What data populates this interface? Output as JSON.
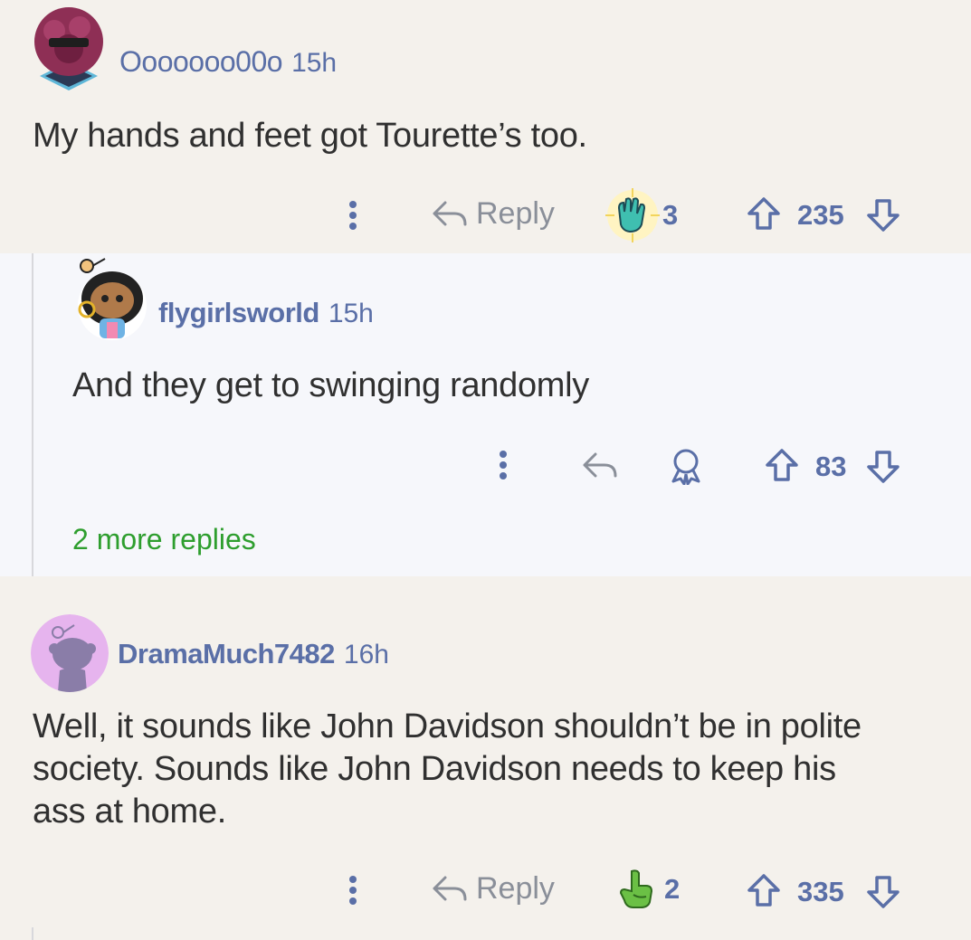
{
  "comments": [
    {
      "username": "Ooooooo00o",
      "time": "15h",
      "body": "My hands and feet got Tourette’s too.",
      "reply_label": "Reply",
      "award_count": "3",
      "score": "235"
    },
    {
      "username": "flygirlsworld",
      "time": "15h",
      "body": "And they get to swinging randomly",
      "score": "83",
      "more_replies": "2 more replies"
    },
    {
      "username": "DramaMuch7482",
      "time": "16h",
      "body_lines": [
        "Well, it sounds like John Davidson shouldn’t be in polite",
        "society. Sounds like John Davidson needs to keep his",
        "ass at home."
      ],
      "reply_label": "Reply",
      "award_count": "2",
      "score": "335"
    }
  ],
  "colors": {
    "accent": "#5a6fa7",
    "more_replies": "#2e9e2e",
    "background": "#f4f1ec",
    "nested_background": "#f6f7fb"
  },
  "icons": [
    "overflow-dots-icon",
    "reply-arrow-icon",
    "award-icon",
    "upvote-icon",
    "downvote-icon"
  ]
}
